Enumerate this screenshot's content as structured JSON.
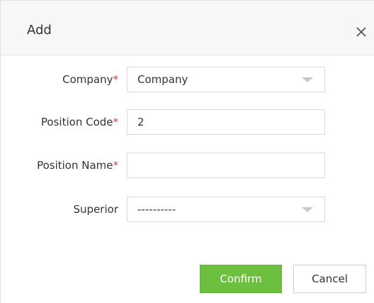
{
  "dialog": {
    "title": "Add",
    "close_icon": "close-icon"
  },
  "form": {
    "required_mark": "*",
    "company": {
      "label": "Company",
      "value": "Company",
      "icon": "dropdown-caret-icon"
    },
    "position_code": {
      "label": "Position Code",
      "value": "2"
    },
    "position_name": {
      "label": "Position Name",
      "value": ""
    },
    "superior": {
      "label": "Superior",
      "value": "----------",
      "icon": "dropdown-caret-icon"
    }
  },
  "actions": {
    "confirm_label": "Confirm",
    "cancel_label": "Cancel"
  },
  "colors": {
    "accent": "#6cbf3f",
    "required": "#e83c3c",
    "header_bg": "#f7f7f7"
  }
}
